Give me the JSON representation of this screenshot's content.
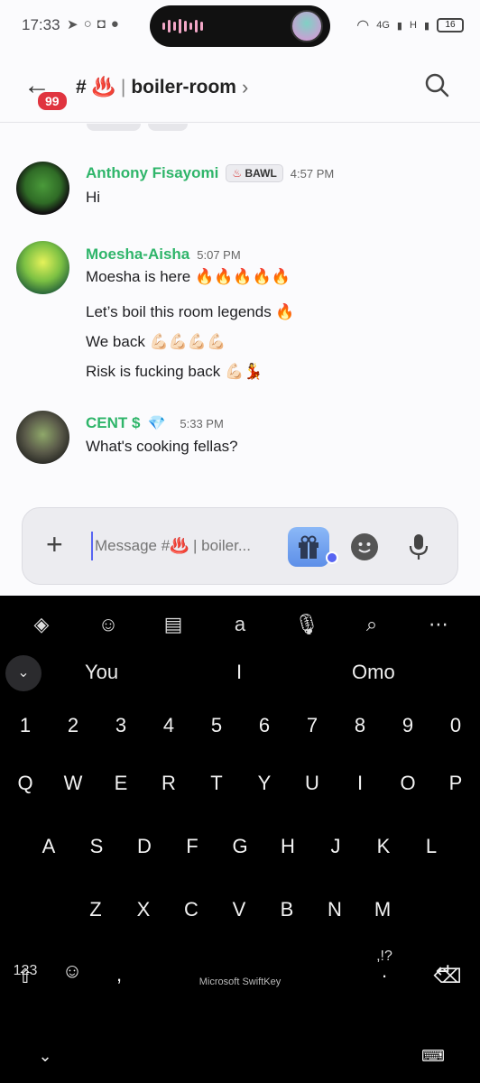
{
  "status": {
    "time": "17:33",
    "net1": "4G",
    "net2": "H",
    "battery": "16"
  },
  "header": {
    "badge": "99",
    "hash": "#",
    "channel_emoji": "♨️",
    "channel_name": "boiler-room"
  },
  "messages": [
    {
      "user": "Anthony Fisayomi",
      "tag": "BAWL",
      "time": "4:57 PM",
      "lines": [
        "Hi"
      ]
    },
    {
      "user": "Moesha-Aisha",
      "time": "5:07 PM",
      "lines": [
        "Moesha is here 🔥🔥🔥🔥🔥",
        "Let’s boil this room legends 🔥",
        "We back 💪🏻💪🏻💪🏻💪🏻",
        "Risk is fucking back 💪🏻💃"
      ]
    },
    {
      "user": "CENT $",
      "user_badge": "💎",
      "time": "5:33 PM",
      "lines": [
        "What's cooking fellas?"
      ]
    }
  ],
  "input": {
    "placeholder": "Message #♨️ | boiler..."
  },
  "keyboard": {
    "suggestions": [
      "You",
      "I",
      "Omo"
    ],
    "row_numbers": [
      "1",
      "2",
      "3",
      "4",
      "5",
      "6",
      "7",
      "8",
      "9",
      "0"
    ],
    "row_q": [
      "Q",
      "W",
      "E",
      "R",
      "T",
      "Y",
      "U",
      "I",
      "O",
      "P"
    ],
    "row_a": [
      "A",
      "S",
      "D",
      "F",
      "G",
      "H",
      "J",
      "K",
      "L"
    ],
    "row_z": [
      "Z",
      "X",
      "C",
      "V",
      "B",
      "N",
      "M"
    ],
    "mode_key": "123",
    "comma_key": ",",
    "period_key": ".",
    "punct_hint": ",!?",
    "brand": "Microsoft SwiftKey"
  }
}
